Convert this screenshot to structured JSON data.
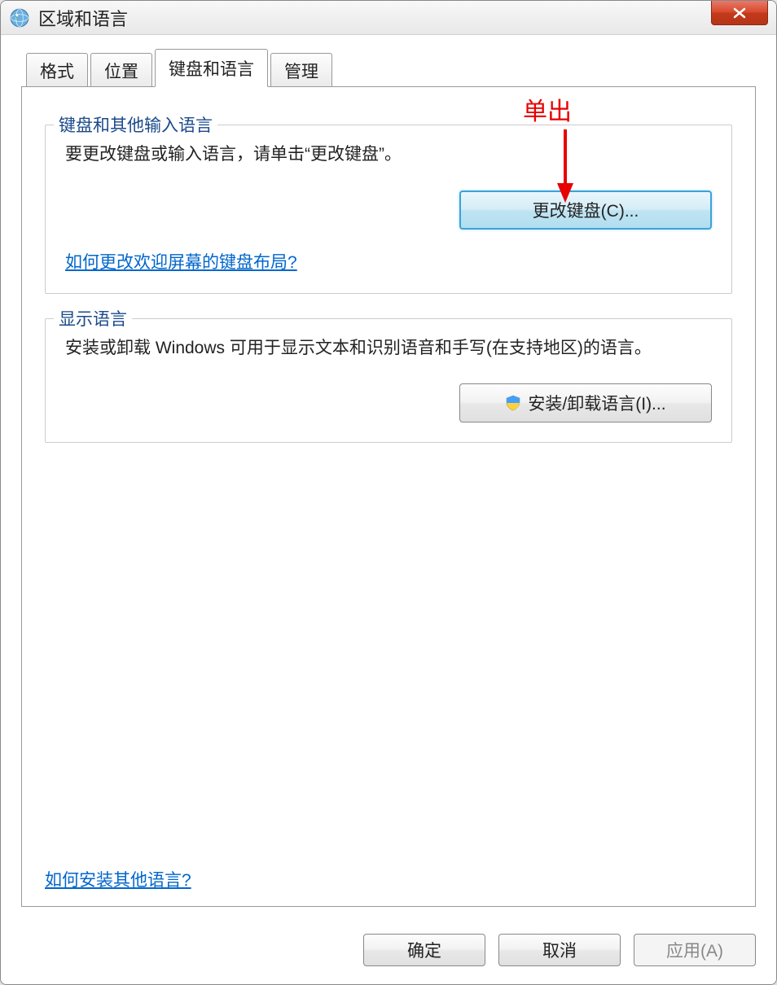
{
  "window": {
    "title": "区域和语言"
  },
  "tabs": [
    {
      "label": "格式"
    },
    {
      "label": "位置"
    },
    {
      "label": "键盘和语言"
    },
    {
      "label": "管理"
    }
  ],
  "annotation": {
    "label": "单出"
  },
  "group1": {
    "legend": "键盘和其他输入语言",
    "text": "要更改键盘或输入语言，请单击“更改键盘”。",
    "button": "更改键盘(C)...",
    "link": "如何更改欢迎屏幕的键盘布局?"
  },
  "group2": {
    "legend": "显示语言",
    "text": "安装或卸载 Windows 可用于显示文本和识别语音和手写(在支持地区)的语言。",
    "button": "安装/卸载语言(I)..."
  },
  "footer_link": "如何安装其他语言?",
  "buttons": {
    "ok": "确定",
    "cancel": "取消",
    "apply": "应用(A)"
  }
}
